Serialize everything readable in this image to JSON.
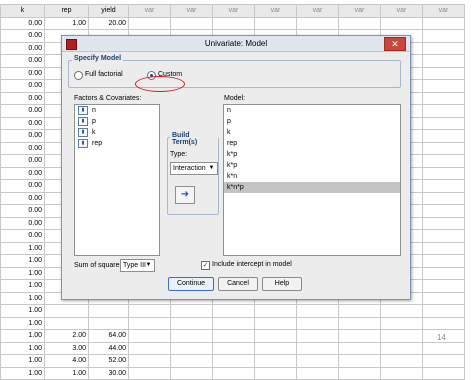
{
  "sheet": {
    "headers": [
      "k",
      "rep",
      "yield",
      "var",
      "var",
      "var",
      "var",
      "var",
      "var",
      "var",
      "var"
    ],
    "rows": [
      [
        "0.00",
        "1.00",
        "20.00",
        "",
        "",
        "",
        "",
        "",
        "",
        "",
        ""
      ],
      [
        "0.00",
        "",
        "",
        "",
        "",
        "",
        "",
        "",
        "",
        "",
        ""
      ],
      [
        "0.00",
        "",
        "",
        "",
        "",
        "",
        "",
        "",
        "",
        "",
        ""
      ],
      [
        "0.00",
        "",
        "",
        "",
        "",
        "",
        "",
        "",
        "",
        "",
        ""
      ],
      [
        "0.00",
        "",
        "",
        "",
        "",
        "",
        "",
        "",
        "",
        "",
        ""
      ],
      [
        "0.00",
        "",
        "",
        "",
        "",
        "",
        "",
        "",
        "",
        "",
        ""
      ],
      [
        "0.00",
        "",
        "",
        "",
        "",
        "",
        "",
        "",
        "",
        "",
        ""
      ],
      [
        "0.00",
        "",
        "",
        "",
        "",
        "",
        "",
        "",
        "",
        "",
        ""
      ],
      [
        "0.00",
        "",
        "",
        "",
        "",
        "",
        "",
        "",
        "",
        "",
        ""
      ],
      [
        "0.00",
        "",
        "",
        "",
        "",
        "",
        "",
        "",
        "",
        "",
        ""
      ],
      [
        "0.00",
        "",
        "",
        "",
        "",
        "",
        "",
        "",
        "",
        "",
        ""
      ],
      [
        "0.00",
        "",
        "",
        "",
        "",
        "",
        "",
        "",
        "",
        "",
        ""
      ],
      [
        "0.00",
        "",
        "",
        "",
        "",
        "",
        "",
        "",
        "",
        "",
        ""
      ],
      [
        "0.00",
        "",
        "",
        "",
        "",
        "",
        "",
        "",
        "",
        "",
        ""
      ],
      [
        "0.00",
        "",
        "",
        "",
        "",
        "",
        "",
        "",
        "",
        "",
        ""
      ],
      [
        "0.00",
        "",
        "",
        "",
        "",
        "",
        "",
        "",
        "",
        "",
        ""
      ],
      [
        "0.00",
        "",
        "",
        "",
        "",
        "",
        "",
        "",
        "",
        "",
        ""
      ],
      [
        "0.00",
        "",
        "",
        "",
        "",
        "",
        "",
        "",
        "",
        "",
        ""
      ],
      [
        "1.00",
        "",
        "",
        "",
        "",
        "",
        "",
        "",
        "",
        "",
        ""
      ],
      [
        "1.00",
        "",
        "",
        "",
        "",
        "",
        "",
        "",
        "",
        "",
        ""
      ],
      [
        "1.00",
        "",
        "",
        "",
        "",
        "",
        "",
        "",
        "",
        "",
        ""
      ],
      [
        "1.00",
        "",
        "",
        "",
        "",
        "",
        "",
        "",
        "",
        "",
        ""
      ],
      [
        "1.00",
        "",
        "",
        "",
        "",
        "",
        "",
        "",
        "",
        "",
        ""
      ],
      [
        "1.00",
        "",
        "",
        "",
        "",
        "",
        "",
        "",
        "",
        "",
        ""
      ],
      [
        "1.00",
        "",
        "",
        "",
        "",
        "",
        "",
        "",
        "",
        "",
        ""
      ],
      [
        "1.00",
        "2.00",
        "64.00",
        "",
        "",
        "",
        "",
        "",
        "",
        "",
        ""
      ],
      [
        "1.00",
        "3.00",
        "44.00",
        "",
        "",
        "",
        "",
        "",
        "",
        "",
        ""
      ],
      [
        "1.00",
        "4.00",
        "52.00",
        "",
        "",
        "",
        "",
        "",
        "",
        "",
        ""
      ],
      [
        "1.00",
        "1.00",
        "30.00",
        "",
        "",
        "",
        "",
        "",
        "",
        "",
        ""
      ]
    ],
    "page_number": "14"
  },
  "dialog": {
    "title": "Univariate: Model",
    "close_glyph": "✕",
    "specify_model": {
      "legend": "Specify Model",
      "options": [
        "Full factorial",
        "Custom"
      ],
      "selected": "Custom"
    },
    "factors_label": "Factors & Covariates:",
    "factors": [
      {
        "icon": "var-icon",
        "name": "n"
      },
      {
        "icon": "var-icon",
        "name": "p"
      },
      {
        "icon": "var-icon",
        "name": "k"
      },
      {
        "icon": "var-icon",
        "name": "rep"
      }
    ],
    "build_terms": {
      "legend": "Build Term(s)",
      "type_label": "Type:",
      "type_value": "Interaction",
      "move_icon": "arrow-right-icon"
    },
    "model_label": "Model:",
    "model_terms": [
      "n",
      "p",
      "k",
      "rep",
      "k*p",
      "k*p",
      "k*n",
      "k*n*p"
    ],
    "selected_model_term": "k*n*p",
    "sum_of_squares_label": "Sum of squares:",
    "sum_of_squares_value": "Type III",
    "include_intercept_label": "Include intercept in model",
    "include_intercept": true,
    "buttons": {
      "continue": "Continue",
      "cancel": "Cancel",
      "help": "Help"
    }
  },
  "colors": {
    "dialog_bg": "#ececec",
    "accent_blue": "#1c3f7a",
    "highlight_ring": "#c0272d",
    "close_red": "#c9463d"
  }
}
